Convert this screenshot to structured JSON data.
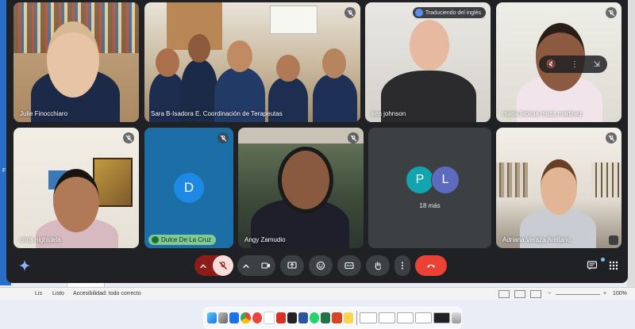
{
  "participants": [
    {
      "name": "Julie Finocchiaro"
    },
    {
      "name": "Sara B-Isadora E. Coordinación de Terapeutas"
    },
    {
      "name": "ken johnson",
      "translation_chip": "Traduciendo del inglés"
    },
    {
      "name": "maria fabiola meza martinez"
    },
    {
      "name": "chris nightdela"
    },
    {
      "name": "Dulce De La Cruz",
      "avatar_letter": "D",
      "avatar_color": "#1e88e5"
    },
    {
      "name": "Angy Zamudio"
    },
    {
      "name": "Adriana Veraza Arellano"
    }
  ],
  "others": {
    "label": "18 más",
    "avatars": [
      {
        "letter": "P",
        "color": "#12a4af"
      },
      {
        "letter": "L",
        "color": "#5c6bc0"
      }
    ]
  },
  "excel_status": {
    "ready": "Listo",
    "accessibility": "Accesibilidad: todo correcto",
    "zoom": "100%"
  },
  "colors": {
    "meet_bg": "#202124",
    "tile_bg": "#3c4043",
    "hangup_red": "#ea4335",
    "mic_off_bg": "#f28b82",
    "speaking_green": "#81c995"
  },
  "controls": [
    "gemini-icon",
    "chevron-up-icon",
    "mic-off-icon",
    "chevron-up-icon",
    "camera-icon",
    "present-icon",
    "emoji-icon",
    "captions-icon",
    "raise-hand-icon",
    "more-icon",
    "hangup-icon",
    "chat-icon",
    "activities-icon"
  ]
}
